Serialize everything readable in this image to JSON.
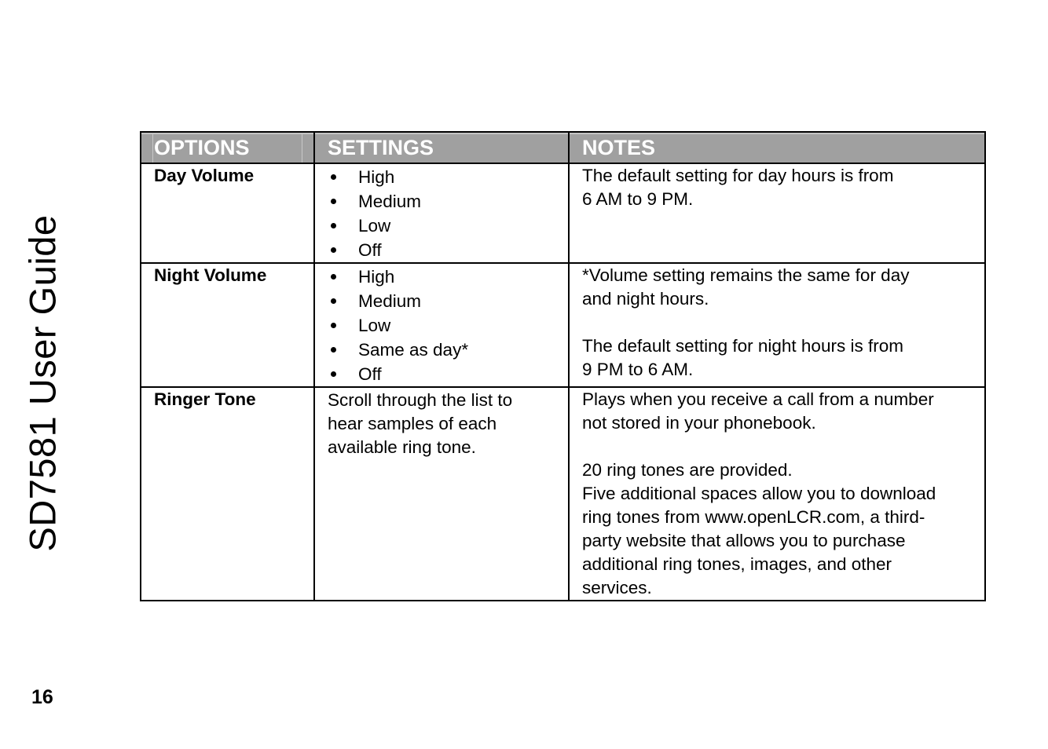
{
  "document": {
    "side_title": "SD7581 User Guide",
    "page_number": "16"
  },
  "table": {
    "headers": [
      "OPTIONS",
      "SETTINGS",
      "NOTES"
    ],
    "rows": [
      {
        "option": "Day Volume",
        "settings": [
          "High",
          "Medium",
          "Low",
          "Off"
        ],
        "notes": [
          [
            "The default setting for day hours is from",
            "6 AM to 9 PM."
          ]
        ]
      },
      {
        "option": "Night Volume",
        "settings": [
          "High",
          "Medium",
          "Low",
          "Same as day*",
          "Off"
        ],
        "notes": [
          [
            "*Volume setting remains the same for day",
            "and night hours."
          ],
          [
            "The default setting for night hours is from",
            "9 PM to 6 AM."
          ]
        ]
      },
      {
        "option": "Ringer Tone",
        "settings_text": [
          "Scroll through the list to",
          "hear samples of each",
          "available ring tone."
        ],
        "notes": [
          [
            "Plays when you receive a call from a number",
            "not stored in your phonebook."
          ],
          [
            "20 ring tones are provided.",
            "Five additional spaces allow you to download",
            "ring tones from www.openLCR.com, a third-",
            "party website that allows you to purchase",
            "additional ring tones, images, and other",
            "services."
          ]
        ]
      }
    ]
  }
}
